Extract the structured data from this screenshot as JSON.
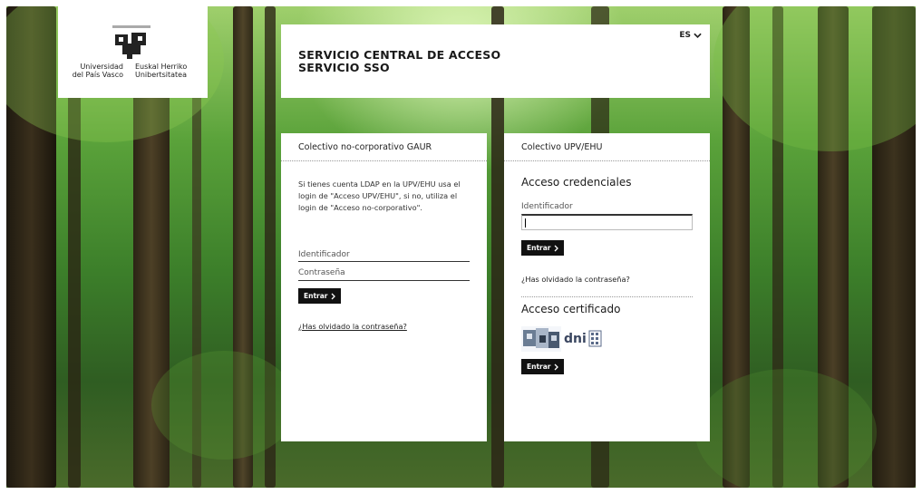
{
  "logo": {
    "left_line1": "Universidad",
    "left_line2": "del País Vasco",
    "right_line1": "Euskal Herriko",
    "right_line2": "Unibertsitatea"
  },
  "header": {
    "title_line1": "SERVICIO CENTRAL DE ACCESO",
    "title_line2": "SERVICIO SSO",
    "language": "ES"
  },
  "gaur": {
    "title": "Colectivo no-corporativo GAUR",
    "info": "Si tienes cuenta LDAP en la UPV/EHU usa el login de \"Acceso UPV/EHU\", si no, utiliza el login de \"Acceso no-corporativo\".",
    "identifier_label": "Identificador",
    "password_label": "Contraseña",
    "submit_label": "Entrar",
    "forgot_label": "¿Has olvidado la contraseña?"
  },
  "upv": {
    "title": "Colectivo UPV/EHU",
    "credentials_title": "Acceso credenciales",
    "identifier_label": "Identificador",
    "identifier_value": "",
    "submit_label": "Entrar",
    "forgot_label": "¿Has olvidado la contraseña?",
    "certificate_title": "Acceso certificado",
    "dni_text": "dni",
    "cert_submit_label": "Entrar"
  },
  "colors": {
    "button_bg": "#111111",
    "panel_bg": "#ffffff",
    "forest_green": "#3c7f2a"
  }
}
